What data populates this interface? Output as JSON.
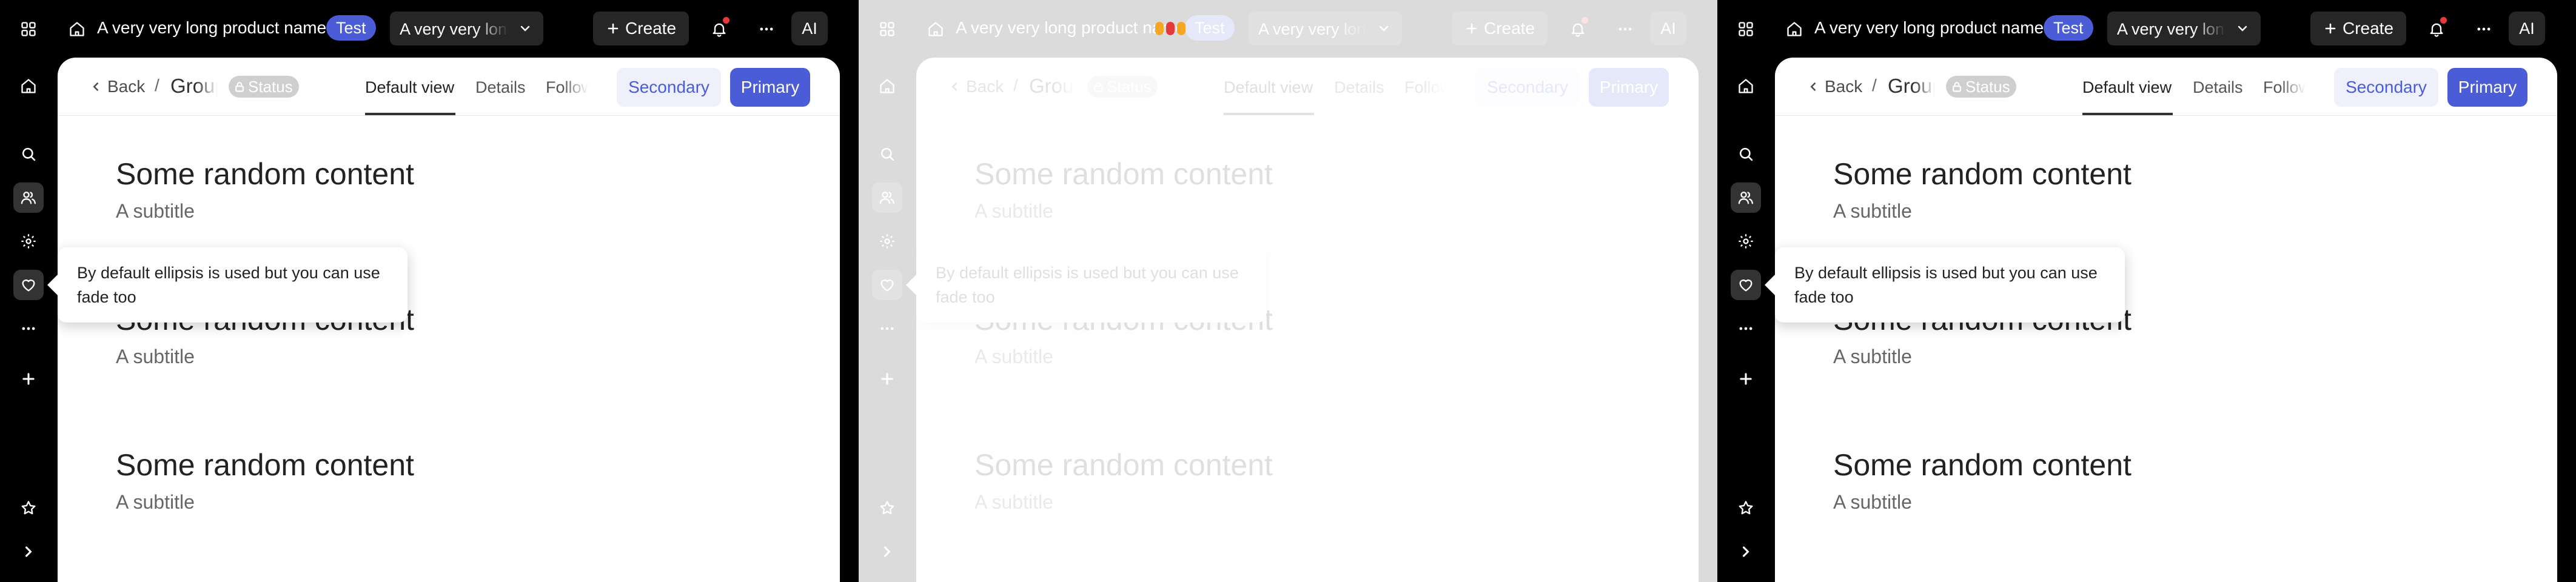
{
  "app": {
    "product_name": "A very very long product name",
    "badge": "Test",
    "select_value": "A very very long name",
    "create_label": "Create",
    "ai_label": "AI"
  },
  "header": {
    "back_label": "Back",
    "breadcrumb_sep": "/",
    "group_label": "Group name",
    "status_label": "Status",
    "tabs": [
      "Default view",
      "Details",
      "Followers"
    ],
    "secondary_label": "Secondary",
    "primary_label": "Primary"
  },
  "content": {
    "blocks": [
      {
        "title": "Some random content",
        "subtitle": "A subtitle"
      },
      {
        "title": "Some random content",
        "subtitle": "A subtitle"
      },
      {
        "title": "Some random content",
        "subtitle": "A subtitle"
      }
    ]
  },
  "tooltip": {
    "text": "By default ellipsis is used but you can use fade too"
  },
  "icons": {
    "top": [
      "grid-icon",
      "home-icon",
      "chevron-down-icon",
      "plus-icon",
      "bell-icon",
      "more-icon"
    ],
    "rail": [
      "home-icon",
      "search-icon",
      "users-icon",
      "gear-icon",
      "heart-icon",
      "more-icon",
      "plus-icon",
      "star-icon",
      "chevron-right-icon"
    ]
  },
  "colors": {
    "accent": "#4a5cd6",
    "secondary_bg": "#eef0fb",
    "shell": "#000000",
    "notification_dot": "#e63a3a"
  }
}
